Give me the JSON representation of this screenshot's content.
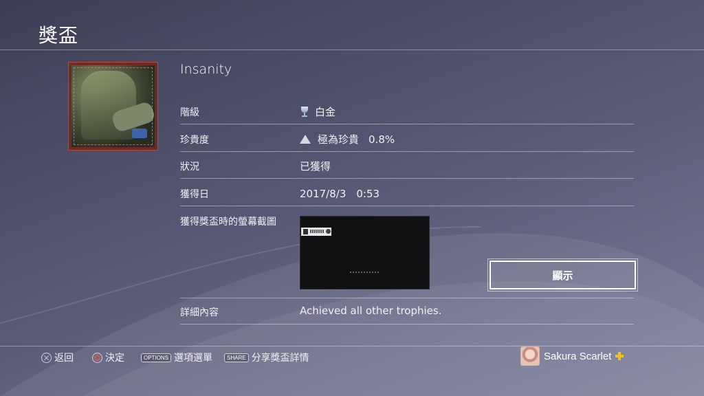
{
  "page": {
    "title": "獎盃"
  },
  "trophy": {
    "name": "Insanity",
    "rows": {
      "grade": {
        "label": "階級",
        "value": "白金",
        "icon": "platinum-trophy-icon"
      },
      "rarity": {
        "label": "珍貴度",
        "value": "極為珍貴",
        "percent": "0.8%",
        "icon": "rarity-triangle-icon"
      },
      "status": {
        "label": "狀況",
        "value": "已獲得"
      },
      "earned_date": {
        "label": "獲得日",
        "value": "2017/8/3　0:53"
      },
      "screenshot": {
        "label": "獲得獎盃時的螢幕截圖"
      },
      "details": {
        "label": "詳細內容",
        "value": "Achieved all other trophies."
      }
    },
    "show_button_label": "顯示"
  },
  "footer": {
    "back_label": "返回",
    "confirm_label": "決定",
    "options_key": "OPTIONS",
    "options_label": "選項選單",
    "share_key": "SHARE",
    "share_label": "分享獎盃詳情"
  },
  "user": {
    "name": "Sakura Scarlet"
  },
  "colors": {
    "background": "#4d4e68",
    "plus_badge": "#f2c21a",
    "confirm_circle": "#e0534a",
    "trophy_frame": "#6e2a24"
  }
}
